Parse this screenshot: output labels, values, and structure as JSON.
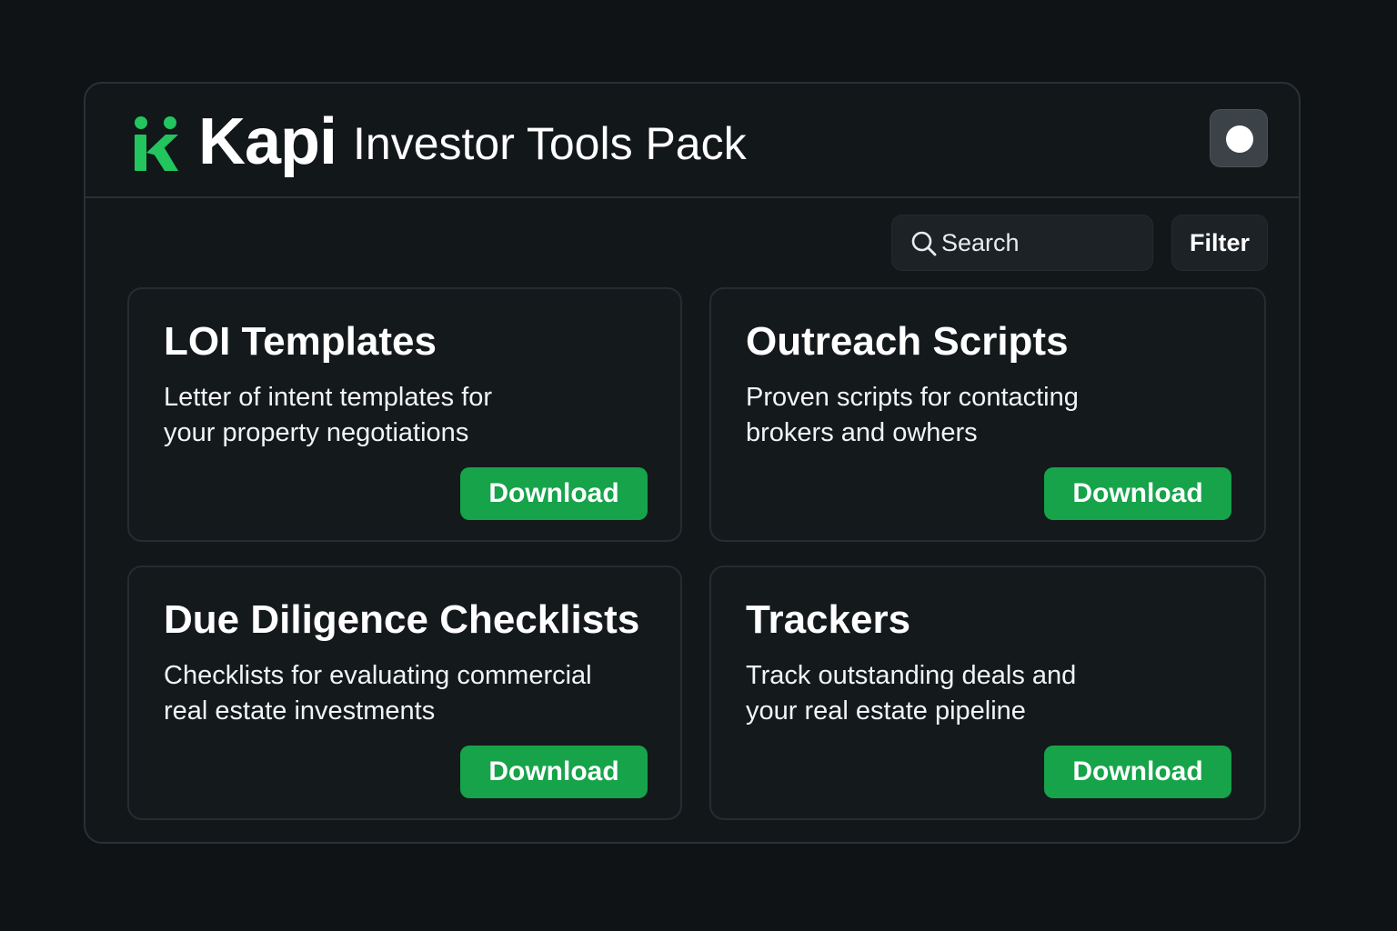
{
  "header": {
    "brand": "Kapi",
    "title": "Investor Tools Pack",
    "logo_icon": "kapi-logo-icon",
    "toggle_icon": "toggle-dot-icon"
  },
  "toolbar": {
    "search_placeholder": "Search",
    "search_icon": "search-icon",
    "filter_label": "Filter"
  },
  "cards": [
    {
      "title": "LOI Templates",
      "desc_line1": "Letter of intent templates for",
      "desc_line2": "your property negotiations",
      "button": "Download"
    },
    {
      "title": "Outreach Scripts",
      "desc_line1": "Proven scripts for contacting",
      "desc_line2": "brokers and owhers",
      "button": "Download"
    },
    {
      "title": "Due Diligence Checklists",
      "desc_line1": "Checklists for evaluating commercial",
      "desc_line2": "real estate investments",
      "button": "Download"
    },
    {
      "title": "Trackers",
      "desc_line1": "Track outstanding deals and",
      "desc_line2": "your real estate pipeline",
      "button": "Download"
    }
  ],
  "colors": {
    "accent": "#16a34a",
    "logo": "#22c55e",
    "background": "#0f1316",
    "panel": "#12171a"
  }
}
